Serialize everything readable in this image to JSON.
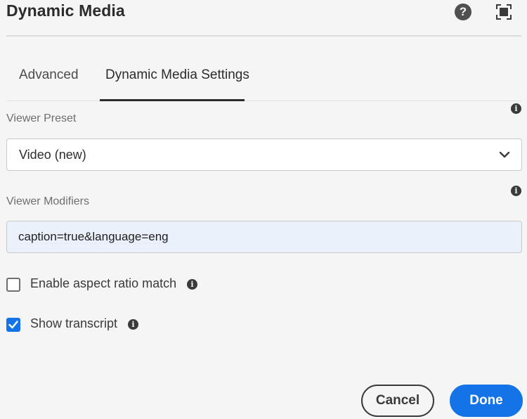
{
  "dialog": {
    "title": "Dynamic Media",
    "help_icon": "question-circle-icon",
    "fullscreen_icon": "fullscreen-icon",
    "help_glyph": "?"
  },
  "tabs": [
    {
      "label": "Advanced",
      "selected": false
    },
    {
      "label": "Dynamic Media Settings",
      "selected": true
    }
  ],
  "viewer_preset": {
    "label": "Viewer Preset",
    "value": "Video (new)",
    "info_icon": "info-icon"
  },
  "viewer_modifiers": {
    "label": "Viewer Modifiers",
    "value": "caption=true&language=eng",
    "info_icon": "info-icon"
  },
  "checkboxes": [
    {
      "label": "Enable aspect ratio match",
      "checked": false
    },
    {
      "label": "Show transcript",
      "checked": true
    }
  ],
  "info_glyph": "i",
  "buttons": {
    "cancel": "Cancel",
    "done": "Done"
  },
  "colors": {
    "accent": "#1473e6",
    "background": "#f5f5f5",
    "text": "#2c2c2c",
    "input_highlight": "#eaf1fb"
  }
}
